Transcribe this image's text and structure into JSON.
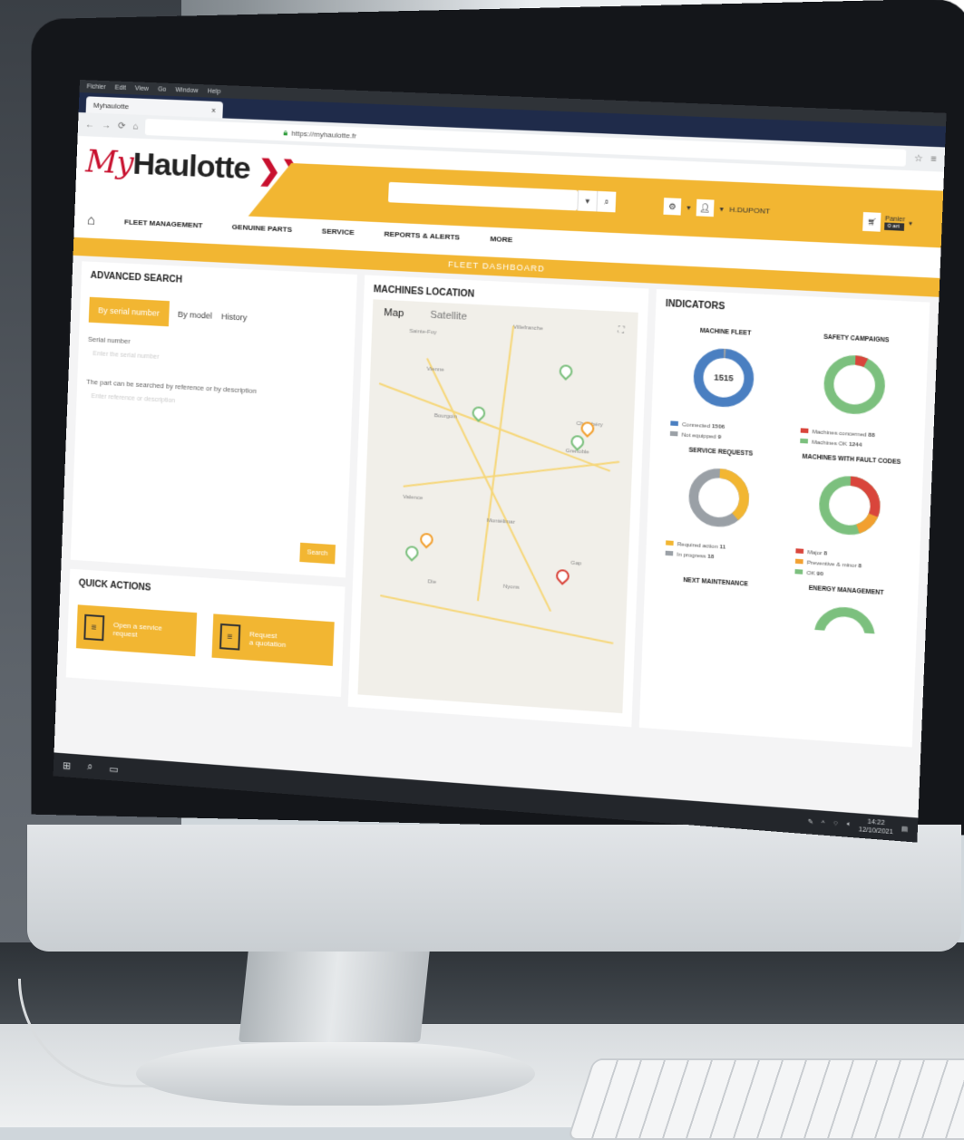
{
  "browser": {
    "os_menu": [
      "Fichier",
      "Edit",
      "View",
      "Go",
      "Window",
      "Help"
    ],
    "tab_title": "Myhaulotte",
    "tab_close": "x",
    "url": "https://myhaulotte.fr"
  },
  "header": {
    "logo_my": "My",
    "logo_main": "Haulotte",
    "user_label": "H.DUPONT",
    "cart_label": "Panier",
    "cart_badge": "0 art",
    "nav": [
      "FLEET MANAGEMENT",
      "GENUINE PARTS",
      "SERVICE",
      "REPORTS & ALERTS",
      "MORE"
    ]
  },
  "dashboard_title": "FLEET DASHBOARD",
  "advanced_search": {
    "title": "ADVANCED SEARCH",
    "tabs": [
      "By serial number",
      "By model",
      "History"
    ],
    "serial_label": "Serial number",
    "serial_placeholder": "Enter the serial number",
    "hint": "The part can be searched by reference or by description",
    "hint_placeholder": "Enter reference or description",
    "search_button": "Search"
  },
  "quick_actions": {
    "title": "QUICK ACTIONS",
    "open_service_l1": "Open a service",
    "open_service_l2": "request",
    "quotation_l1": "Request",
    "quotation_l2": "a quotation"
  },
  "machines_location": {
    "title": "MACHINES LOCATION",
    "map_tab": "Map",
    "satellite_tab": "Satellite",
    "towns": [
      "Sainte-Foy",
      "Villefranche",
      "Vienne",
      "Bourgoin",
      "Chambéry",
      "Grenoble",
      "Valence",
      "Montélimar",
      "Die",
      "Gap",
      "Nyons"
    ]
  },
  "indicators": {
    "title": "INDICATORS",
    "machine_fleet": {
      "title": "MACHINE FLEET",
      "center": "1515",
      "legend": [
        {
          "label": "Connected",
          "value": "1506",
          "color": "#4a7fc1"
        },
        {
          "label": "Not equipped",
          "value": "9",
          "color": "#9aa0a6"
        }
      ]
    },
    "safety_campaigns": {
      "title": "SAFETY CAMPAIGNS",
      "legend": [
        {
          "label": "Machines concerned",
          "value": "88",
          "color": "#d9453b"
        },
        {
          "label": "Machines OK",
          "value": "1244",
          "color": "#7cc07e"
        }
      ]
    },
    "service_requests": {
      "title": "SERVICE REQUESTS",
      "legend": [
        {
          "label": "Required action",
          "value": "11",
          "color": "#f2b632"
        },
        {
          "label": "In progress",
          "value": "18",
          "color": "#9aa0a6"
        }
      ]
    },
    "fault_codes": {
      "title": "MACHINES WITH FAULT CODES",
      "legend": [
        {
          "label": "Major",
          "value": "8",
          "color": "#d9453b"
        },
        {
          "label": "Preventive & minor",
          "value": "8",
          "color": "#f2a030"
        },
        {
          "label": "OK",
          "value": "90",
          "color": "#7cc07e"
        }
      ]
    },
    "next_maintenance": {
      "title": "NEXT MAINTENANCE"
    },
    "energy_management": {
      "title": "ENERGY MANAGEMENT"
    }
  },
  "taskbar": {
    "time": "14:22",
    "date": "12/10/2021"
  }
}
